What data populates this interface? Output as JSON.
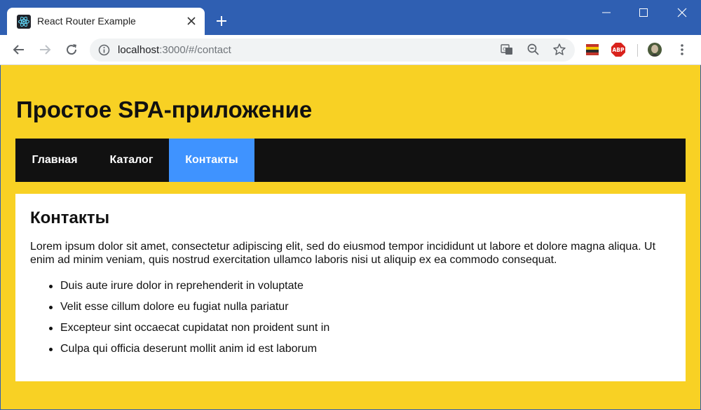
{
  "browser": {
    "tab_title": "React Router Example",
    "url_host": "localhost",
    "url_rest": ":3000/#/contact"
  },
  "colors": {
    "titlebar": "#2f5fb2",
    "page_background": "#f8d124",
    "nav_background": "#111111",
    "nav_active": "#3f93ff"
  },
  "icons": [
    "react-favicon-icon",
    "close-icon",
    "plus-icon",
    "minimize-icon",
    "maximize-icon",
    "window-close-icon",
    "back-arrow-icon",
    "forward-arrow-icon",
    "reload-icon",
    "info-icon",
    "translate-icon",
    "zoom-out-icon",
    "star-icon",
    "flag-extension-icon",
    "adblock-extension-icon",
    "profile-avatar-icon",
    "more-vert-icon"
  ],
  "extensions": {
    "adblock_label": "ABP"
  },
  "site": {
    "title": "Простое SPA-приложение"
  },
  "nav": {
    "items": [
      {
        "label": "Главная"
      },
      {
        "label": "Каталог"
      },
      {
        "label": "Контакты"
      }
    ],
    "active_index": 2
  },
  "content": {
    "heading": "Контакты",
    "paragraph": "Lorem ipsum dolor sit amet, consectetur adipiscing elit, sed do eiusmod tempor incididunt ut labore et dolore magna aliqua. Ut enim ad minim veniam, quis nostrud exercitation ullamco laboris nisi ut aliquip ex ea commodo consequat.",
    "list": [
      "Duis aute irure dolor in reprehenderit in voluptate",
      "Velit esse cillum dolore eu fugiat nulla pariatur",
      "Excepteur sint occaecat cupidatat non proident sunt in",
      "Culpa qui officia deserunt mollit anim id est laborum"
    ]
  }
}
